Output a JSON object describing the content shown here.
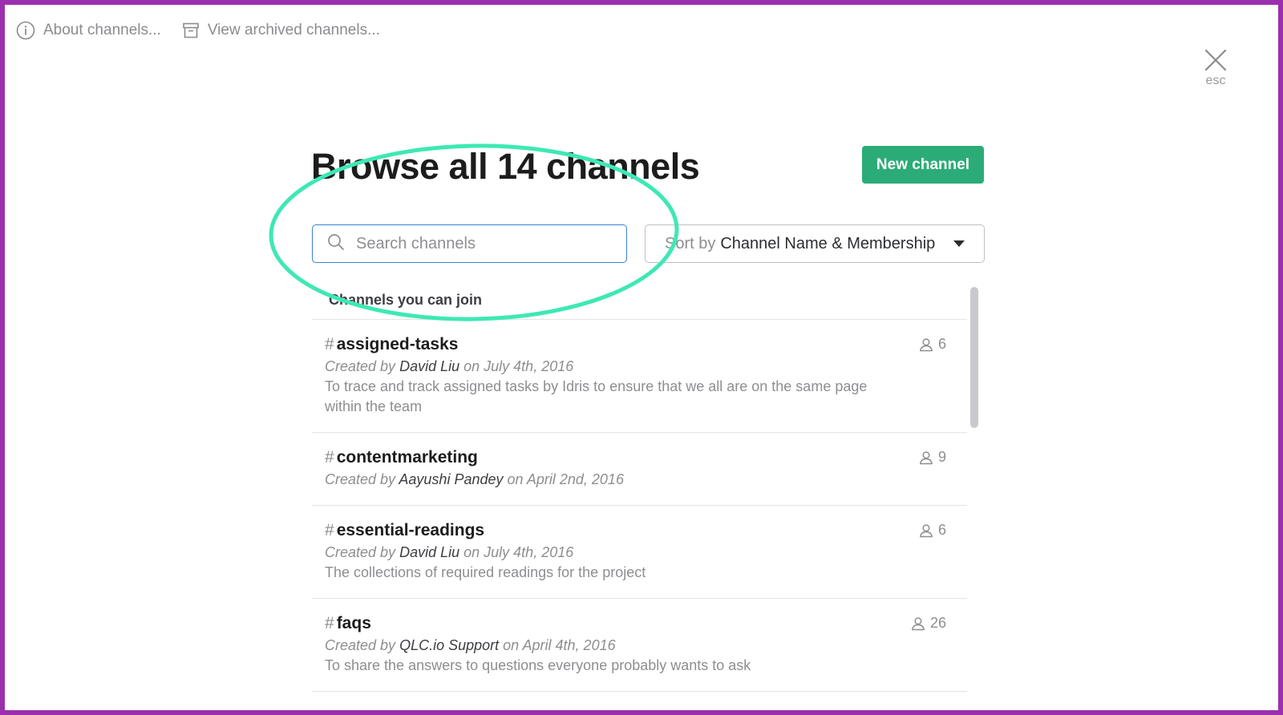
{
  "top_links": {
    "about": "About channels...",
    "archived": "View archived channels..."
  },
  "close": {
    "esc_label": "esc"
  },
  "header": {
    "title": "Browse all 14 channels",
    "new_channel_label": "New channel"
  },
  "search": {
    "placeholder": "Search channels",
    "value": ""
  },
  "sort": {
    "prefix": "Sort by",
    "value": "Channel Name & Membership"
  },
  "list": {
    "section_label": "Channels you can join",
    "created_by_prefix": "Created by",
    "channels": [
      {
        "name": "assigned-tasks",
        "creator": "David Liu",
        "date_text": "on July 4th, 2016",
        "description": "To trace and track assigned tasks by Idris to ensure that we all are on the same page within the team",
        "members": "6"
      },
      {
        "name": "contentmarketing",
        "creator": "Aayushi Pandey",
        "date_text": "on April 2nd, 2016",
        "description": "",
        "members": "9"
      },
      {
        "name": "essential-readings",
        "creator": "David Liu",
        "date_text": "on July 4th, 2016",
        "description": "The collections of required readings for the project",
        "members": "6"
      },
      {
        "name": "faqs",
        "creator": "QLC.io Support",
        "date_text": "on April 4th, 2016",
        "description": "To share the answers to questions everyone probably wants to ask",
        "members": "26"
      }
    ]
  },
  "colors": {
    "accent_green": "#2bac76",
    "focus_blue": "#3b7fd6",
    "annotation": "#3ee8b5",
    "frame": "#9b2fae"
  },
  "icons": {
    "about": "info-circle-icon",
    "archived": "archive-box-icon",
    "close": "close-icon",
    "search": "search-icon",
    "sort": "caret-down-icon",
    "members": "person-icon"
  }
}
